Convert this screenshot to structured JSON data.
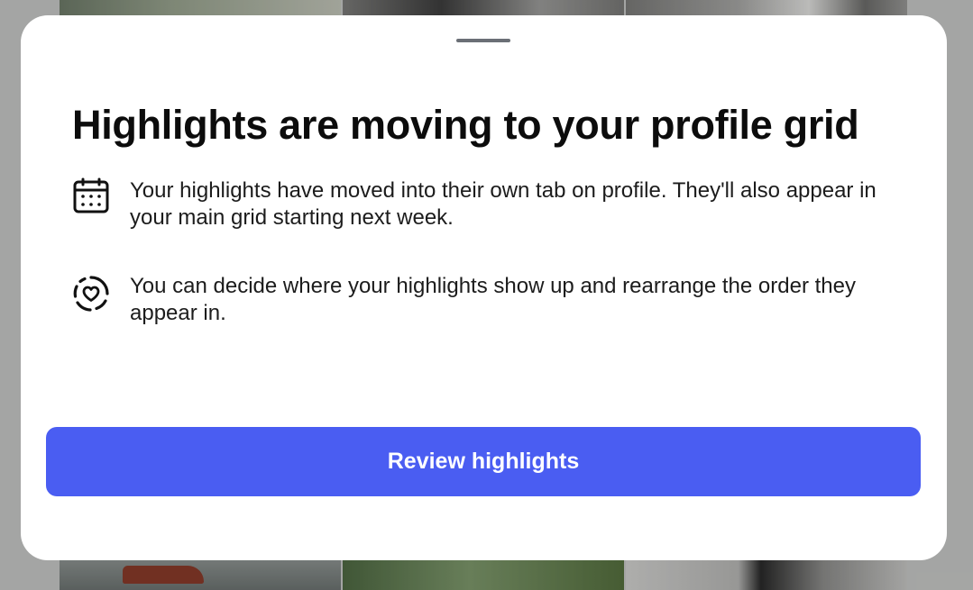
{
  "sheet": {
    "title": "Highlights are moving to your profile grid",
    "items": [
      {
        "icon": "calendar-icon",
        "text": "Your highlights have moved into their own tab on profile. They'll also appear in your main grid starting next week."
      },
      {
        "icon": "heart-circle-icon",
        "text": "You can decide where your highlights show up and rearrange the order they appear in."
      }
    ],
    "primary_button_label": "Review highlights"
  },
  "colors": {
    "button": "#4a5df2",
    "sheet": "#ffffff",
    "text": "#0c0c0c"
  }
}
